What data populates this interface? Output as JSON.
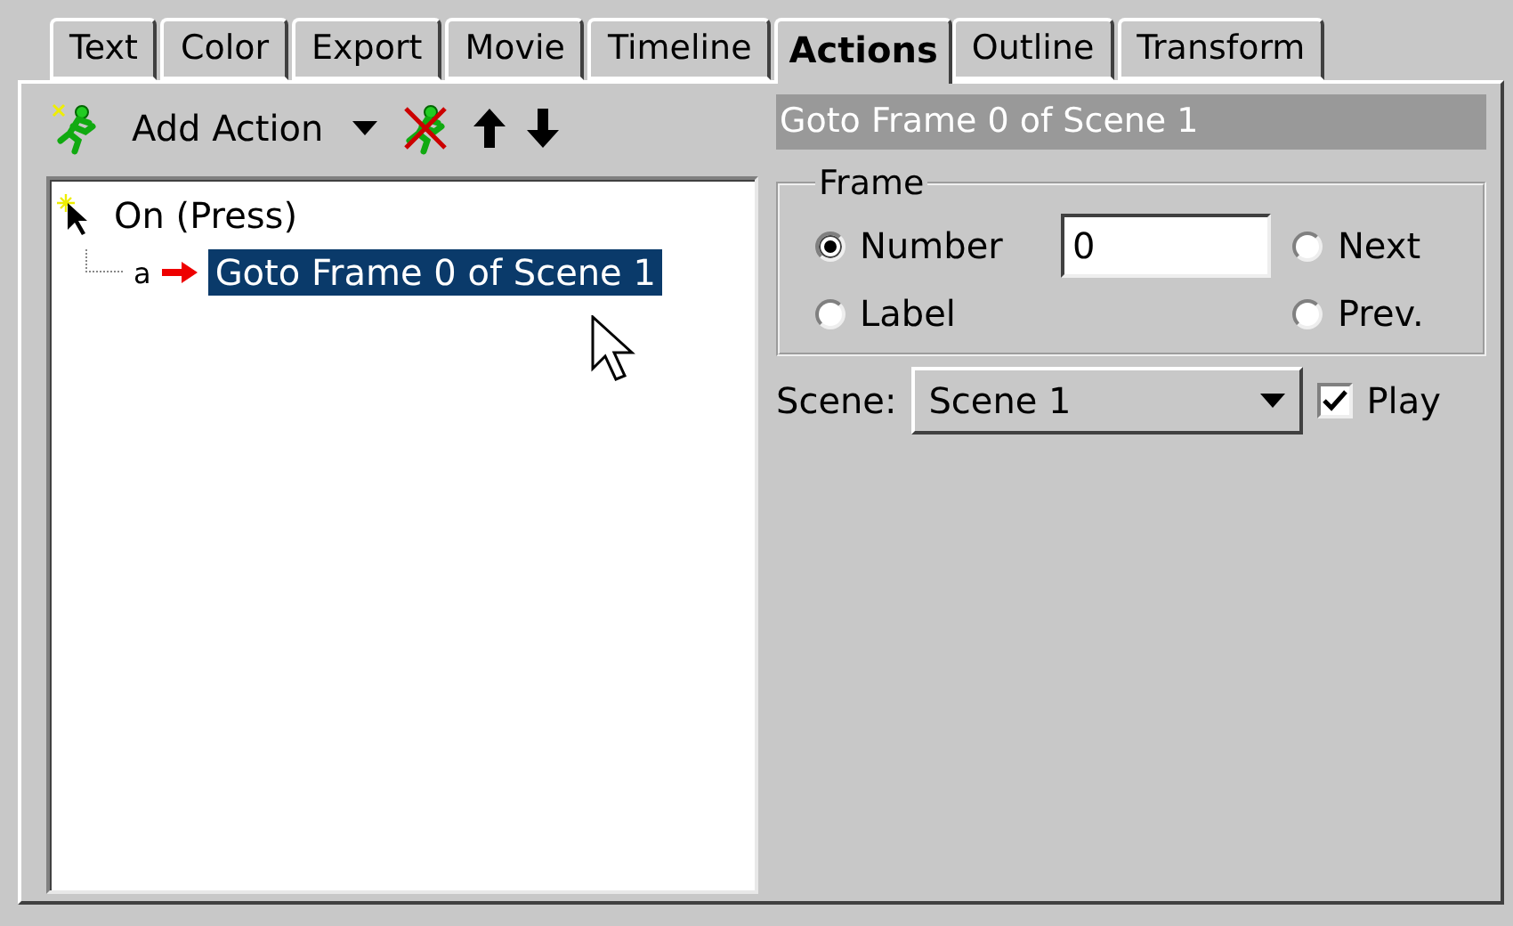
{
  "tabs": [
    {
      "label": "Text",
      "selected": false
    },
    {
      "label": "Color",
      "selected": false
    },
    {
      "label": "Export",
      "selected": false
    },
    {
      "label": "Movie",
      "selected": false
    },
    {
      "label": "Timeline",
      "selected": false
    },
    {
      "label": "Actions",
      "selected": true
    },
    {
      "label": "Outline",
      "selected": false
    },
    {
      "label": "Transform",
      "selected": false
    }
  ],
  "toolbar": {
    "add_action": "Add Action"
  },
  "action_tree": [
    {
      "label": "On (Press)",
      "kind": "event",
      "selected": false,
      "children": [
        {
          "label": "Goto Frame 0 of Scene 1",
          "marker": "a",
          "kind": "action",
          "selected": true
        }
      ]
    }
  ],
  "action_title": "Goto Frame 0 of Scene 1",
  "frame": {
    "legend": "Frame",
    "number_value": "0",
    "options": [
      {
        "label": "Number",
        "selected": true
      },
      {
        "label": "Next",
        "selected": false
      },
      {
        "label": "Label",
        "selected": false
      },
      {
        "label": "Prev.",
        "selected": false
      }
    ]
  },
  "scene": {
    "label": "Scene:",
    "value": "Scene 1"
  },
  "play": {
    "label": "Play",
    "checked": true
  }
}
